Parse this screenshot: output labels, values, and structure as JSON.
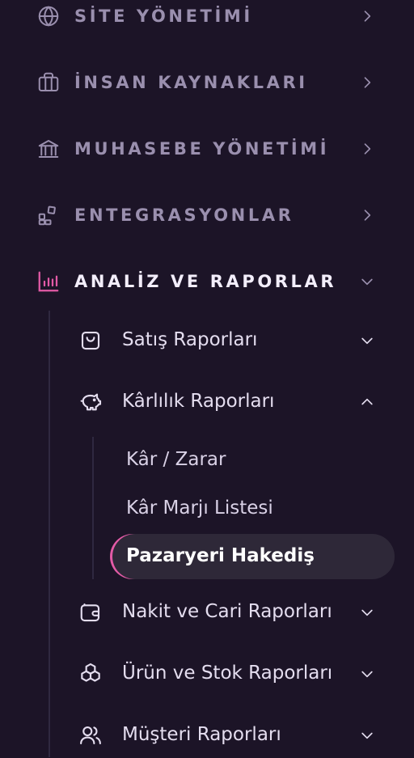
{
  "menu": {
    "sections": [
      {
        "label": "SİTE YÖNETİMİ",
        "icon": "globe-icon"
      },
      {
        "label": "İNSAN KAYNAKLARI",
        "icon": "briefcase-icon"
      },
      {
        "label": "MUHASEBE YÖNETİMİ",
        "icon": "bank-icon"
      },
      {
        "label": "ENTEGRASYONLAR",
        "icon": "puzzle-icon"
      },
      {
        "label": "ANALİZ VE RAPORLAR",
        "icon": "bar-chart-icon"
      }
    ],
    "reports": [
      {
        "label": "Satış Raporları",
        "icon": "shopping-bag-icon"
      },
      {
        "label": "Kârlılık Raporları",
        "icon": "piggy-bank-icon"
      },
      {
        "label": "Nakit ve Cari Raporları",
        "icon": "wallet-icon"
      },
      {
        "label": "Ürün ve Stok Raporları",
        "icon": "boxes-icon"
      },
      {
        "label": "Müşteri Raporları",
        "icon": "users-icon"
      }
    ],
    "profitability": [
      {
        "label": "Kâr / Zarar"
      },
      {
        "label": "Kâr Marjı Listesi"
      },
      {
        "label": "Pazaryeri Hakediş"
      }
    ]
  },
  "colors": {
    "background": "#1c1427",
    "accent": "#e35aa6",
    "active_bg": "#2e2838"
  }
}
